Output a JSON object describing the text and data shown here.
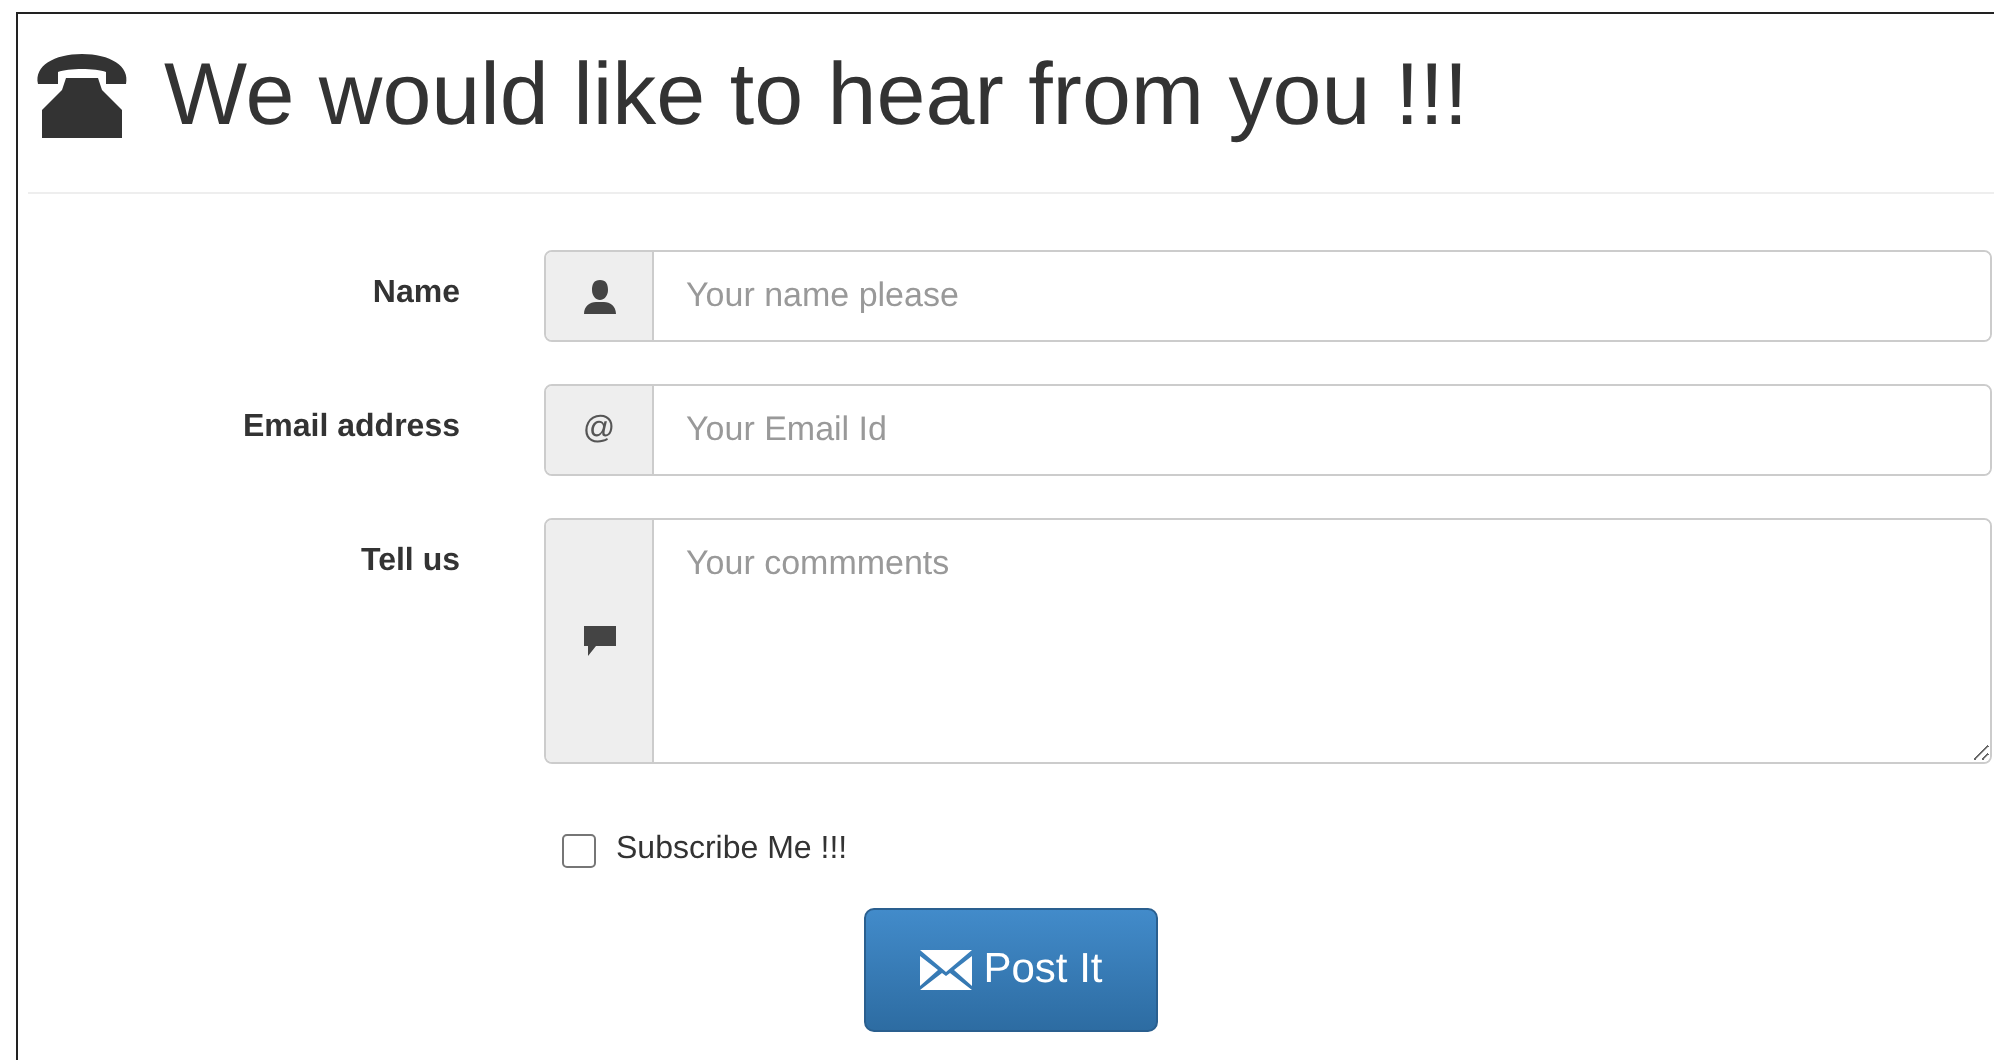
{
  "title": "We would like to hear from you !!!",
  "fields": [
    {
      "kind": "name",
      "label": "Name",
      "placeholder": "Your name please"
    },
    {
      "kind": "email",
      "label": "Email address",
      "addon": "@",
      "placeholder": "Your Email Id"
    },
    {
      "kind": "message",
      "label": "Tell us",
      "placeholder": "Your commments"
    }
  ],
  "subscribe": {
    "label": "Subscribe Me !!!",
    "checked": false
  },
  "submit": {
    "label": "Post It"
  }
}
